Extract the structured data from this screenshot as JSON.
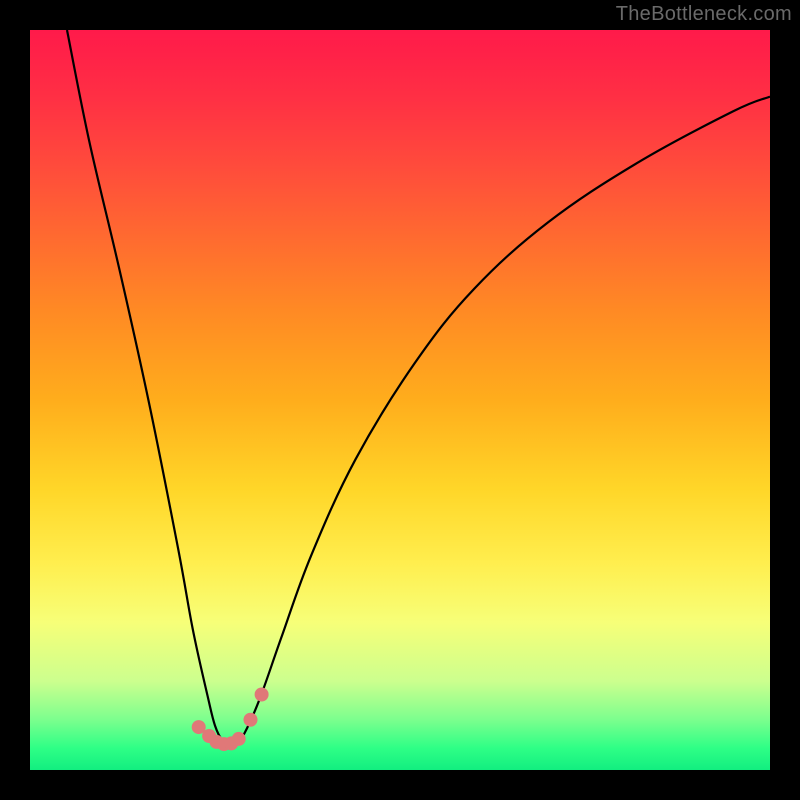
{
  "watermark": "TheBottleneck.com",
  "chart_data": {
    "type": "line",
    "title": "",
    "xlabel": "",
    "ylabel": "",
    "xlim": [
      0,
      100
    ],
    "ylim": [
      0,
      100
    ],
    "series": [
      {
        "name": "bottleneck-curve",
        "x": [
          5,
          8,
          12,
          16,
          20,
          22,
          24,
          25,
          26,
          27,
          28,
          29,
          31,
          34,
          38,
          44,
          52,
          60,
          70,
          82,
          95,
          100
        ],
        "values": [
          100,
          85,
          68,
          50,
          30,
          19,
          10,
          6,
          4,
          3.5,
          3.8,
          5,
          9.5,
          18,
          29,
          42,
          55,
          65,
          74,
          82,
          89,
          91
        ]
      }
    ],
    "markers": {
      "name": "bottom-dots",
      "color": "#e07878",
      "x": [
        22.8,
        24.2,
        25.2,
        26.2,
        27.2,
        28.2,
        29.8,
        31.3
      ],
      "values": [
        5.8,
        4.6,
        3.8,
        3.5,
        3.6,
        4.2,
        6.8,
        10.2
      ],
      "radius": 7
    }
  }
}
